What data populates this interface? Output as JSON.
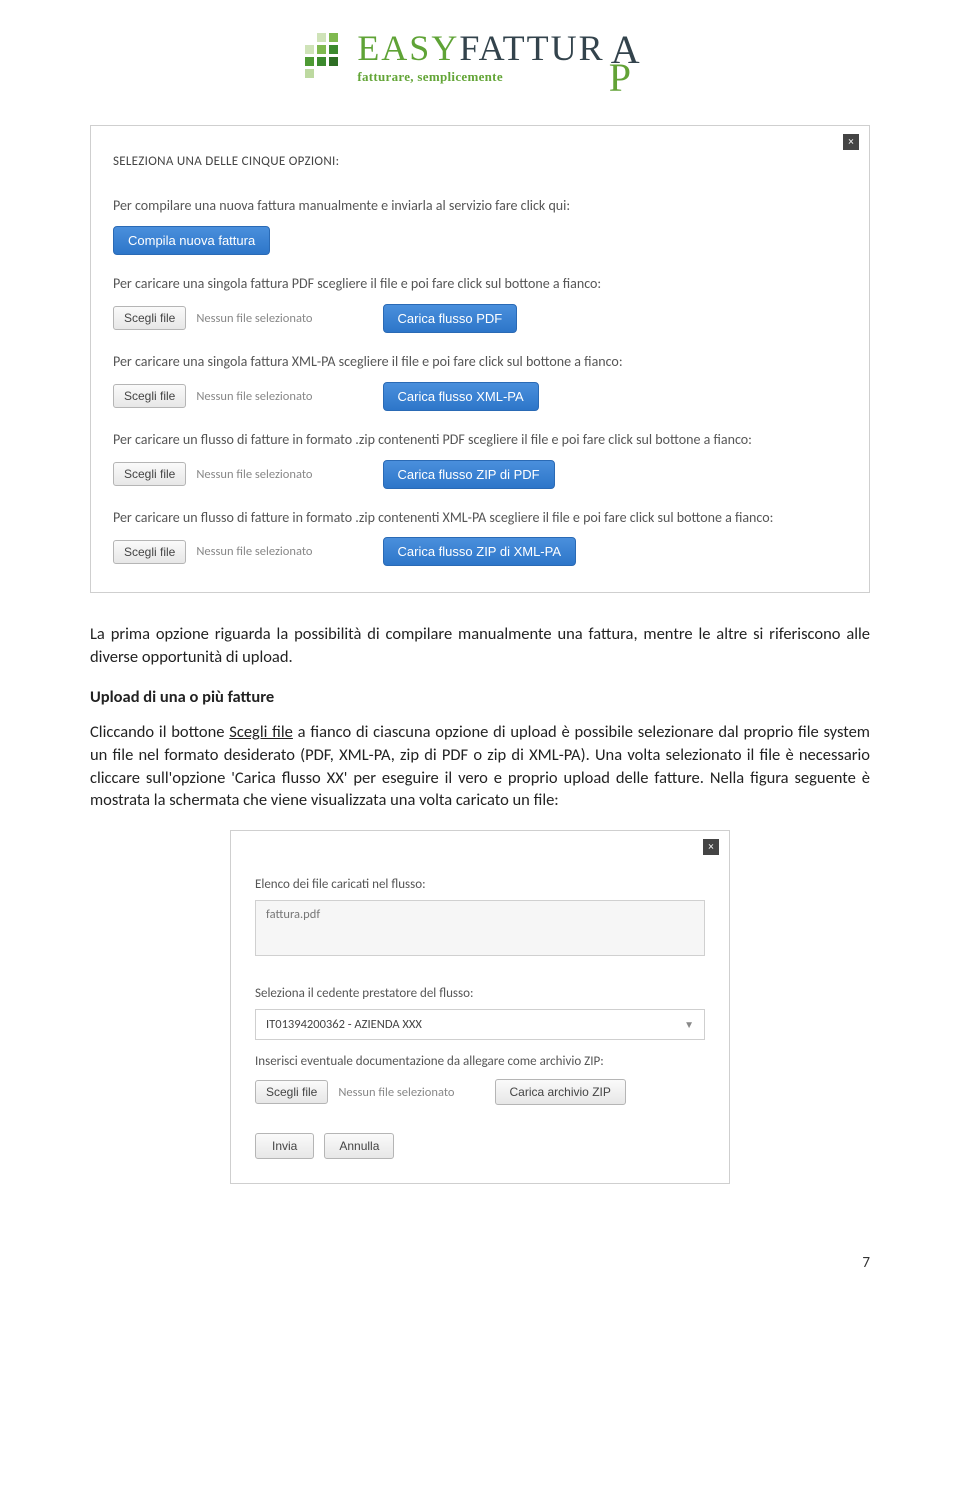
{
  "logo": {
    "brand_prefix": "EASY",
    "brand_suffix": "FATTUR",
    "tagline": "fatturare, semplicemente",
    "pa_a": "A",
    "pa_p": "P"
  },
  "modal1": {
    "close": "×",
    "heading": "SELEZIONA UNA DELLE CINQUE OPZIONI:",
    "option1_desc": "Per compilare una nuova fattura manualmente e inviarla al servizio fare click qui:",
    "option1_btn": "Compila nuova fattura",
    "option2_desc": "Per caricare una singola fattura PDF scegliere il file e poi fare click sul bottone a fianco:",
    "option3_desc": "Per caricare una singola fattura XML-PA scegliere il file e poi fare click sul bottone a fianco:",
    "option4_desc": "Per caricare un flusso di fatture in formato .zip contenenti PDF scegliere il file e poi fare click sul bottone a fianco:",
    "option5_desc": "Per caricare un flusso di fatture in formato .zip contenenti XML-PA scegliere il file e poi fare click sul bottone a fianco:",
    "choose_file": "Scegli file",
    "no_file": "Nessun file selezionato",
    "btn_pdf": "Carica flusso PDF",
    "btn_xmlpa": "Carica flusso XML-PA",
    "btn_zip_pdf": "Carica flusso ZIP di PDF",
    "btn_zip_xmlpa": "Carica flusso ZIP di XML-PA"
  },
  "body": {
    "para1": "La prima opzione riguarda la possibilità di compilare manualmente una fattura, mentre le altre si riferiscono alle diverse opportunità di upload.",
    "subhead": "Upload di una o più fatture",
    "para2_a": "Cliccando il bottone ",
    "para2_u": "Scegli file",
    "para2_b": " a fianco di ciascuna opzione di upload è possibile selezionare dal proprio file system un file nel formato desiderato (PDF, XML-PA, zip di PDF o zip di XML-PA). Una volta selezionato il file è necessario cliccare sull'opzione 'Carica flusso XX' per eseguire il vero e proprio upload delle fatture. Nella figura seguente è mostrata la schermata che viene visualizzata una volta caricato un file:"
  },
  "modal2": {
    "close": "×",
    "lbl_list": "Elenco dei file caricati nel flusso:",
    "file_item": "fattura.pdf",
    "lbl_select": "Seleziona il cedente prestatore del flusso:",
    "select_value": "IT01394200362 - AZIENDA XXX",
    "lbl_zip": "Inserisci eventuale documentazione da allegare come archivio ZIP:",
    "choose_file": "Scegli file",
    "no_file": "Nessun file selezionato",
    "btn_upload_zip": "Carica archivio ZIP",
    "btn_submit": "Invia",
    "btn_cancel": "Annulla"
  },
  "page_num": "7"
}
